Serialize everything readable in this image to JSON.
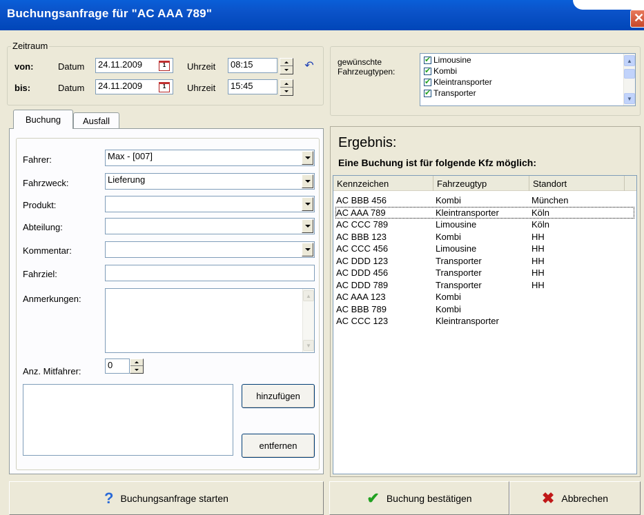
{
  "window": {
    "title": "Buchungsanfrage für \"AC AAA 789\""
  },
  "zeitraum": {
    "legend": "Zeitraum",
    "von": {
      "label": "von:",
      "datum_label": "Datum",
      "date": "24.11.2009",
      "uhrzeit_label": "Uhrzeit",
      "time": "08:15"
    },
    "bis": {
      "label": "bis:",
      "datum_label": "Datum",
      "date": "24.11.2009",
      "uhrzeit_label": "Uhrzeit",
      "time": "15:45"
    }
  },
  "fahrzeugtypen": {
    "label_line1": "gewünschte",
    "label_line2": "Fahrzeugtypen:",
    "items": [
      {
        "label": "Limousine",
        "checked": true
      },
      {
        "label": "Kombi",
        "checked": true
      },
      {
        "label": "Kleintransporter",
        "checked": true
      },
      {
        "label": "Transporter",
        "checked": true
      }
    ]
  },
  "tabs": [
    {
      "label": "Buchung",
      "active": true
    },
    {
      "label": "Ausfall",
      "active": false
    }
  ],
  "form": {
    "fahrer": {
      "label": "Fahrer:",
      "value": "Max - [007]"
    },
    "fahrzweck": {
      "label": "Fahrzweck:",
      "value": "Lieferung"
    },
    "produkt": {
      "label": "Produkt:",
      "value": ""
    },
    "abteilung": {
      "label": "Abteilung:",
      "value": ""
    },
    "kommentar": {
      "label": "Kommentar:",
      "value": ""
    },
    "fahrziel": {
      "label": "Fahrziel:",
      "value": ""
    },
    "anmerkungen": {
      "label": "Anmerkungen:",
      "value": ""
    },
    "mitfahrer": {
      "label": "Anz. Mitfahrer:",
      "value": "0"
    },
    "hinzufuegen_label": "hinzufügen",
    "entfernen_label": "entfernen"
  },
  "ergebnis": {
    "title": "Ergebnis:",
    "subtitle": "Eine Buchung ist für folgende Kfz möglich:",
    "columns": [
      "Kennzeichen",
      "Fahrzeugtyp",
      "Standort"
    ],
    "rows": [
      [
        "AC BBB 456",
        "Kombi",
        "München"
      ],
      [
        "AC AAA 789",
        "Kleintransporter",
        "Köln"
      ],
      [
        "AC CCC 789",
        "Limousine",
        "Köln"
      ],
      [
        "AC BBB 123",
        "Kombi",
        "HH"
      ],
      [
        "AC CCC 456",
        "Limousine",
        "HH"
      ],
      [
        "AC DDD 123",
        "Transporter",
        "HH"
      ],
      [
        "AC DDD 456",
        "Transporter",
        "HH"
      ],
      [
        "AC DDD 789",
        "Transporter",
        "HH"
      ],
      [
        "AC AAA 123",
        "Kombi",
        ""
      ],
      [
        "AC BBB 789",
        "Kombi",
        ""
      ],
      [
        "AC CCC 123",
        "Kleintransporter",
        ""
      ]
    ],
    "focused_row": 1
  },
  "buttons": {
    "start": "Buchungsanfrage starten",
    "confirm": "Buchung bestätigen",
    "cancel": "Abbrechen"
  },
  "icons": {
    "start": "question-icon",
    "confirm": "checkmark-icon",
    "cancel": "cross-icon"
  },
  "colors": {
    "titlebar": "#0054e3",
    "accent_check": "#21a121",
    "cancel_x": "#c01818",
    "help": "#2a6ad8"
  }
}
